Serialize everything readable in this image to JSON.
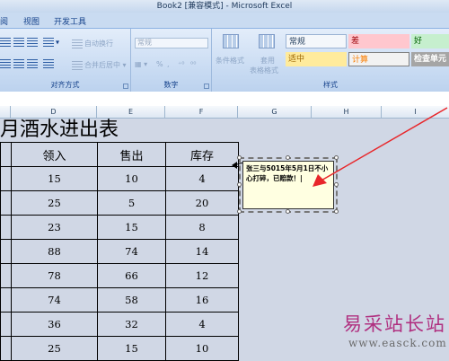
{
  "window": {
    "title": "Book2  [兼容模式] - Microsoft Excel"
  },
  "ribbon_tabs": [
    "阅",
    "视图",
    "开发工具"
  ],
  "ribbon": {
    "alignment_group": {
      "label": "对齐方式",
      "wrap_text": "自动换行",
      "merge_center": "合并后居中"
    },
    "number_group": {
      "label": "数字",
      "format_value": "常规"
    },
    "styles_group": {
      "label": "样式",
      "conditional_format": "条件格式",
      "table_format_line1": "套用",
      "table_format_line2": "表格格式",
      "style_cells": [
        "常规",
        "差",
        "好",
        "适中",
        "计算",
        "检查单元"
      ]
    }
  },
  "columns": [
    "D",
    "E",
    "F",
    "G",
    "H",
    "I"
  ],
  "sheet": {
    "title": "月酒水进出表",
    "headers": [
      "领入",
      "售出",
      "库存"
    ],
    "rows": [
      [
        "15",
        "10",
        "4"
      ],
      [
        "25",
        "5",
        "20"
      ],
      [
        "23",
        "15",
        "8"
      ],
      [
        "88",
        "74",
        "14"
      ],
      [
        "78",
        "66",
        "12"
      ],
      [
        "74",
        "58",
        "16"
      ],
      [
        "36",
        "32",
        "4"
      ],
      [
        "25",
        "15",
        "10"
      ]
    ]
  },
  "comment": {
    "text": "张三与5015年5月1日不小心打碎，已赔款！"
  },
  "watermark": {
    "main": "易采站长站",
    "url": "www.easck.com"
  },
  "colors": {
    "arrow": "#e8262a",
    "watermark": "#b03080"
  }
}
